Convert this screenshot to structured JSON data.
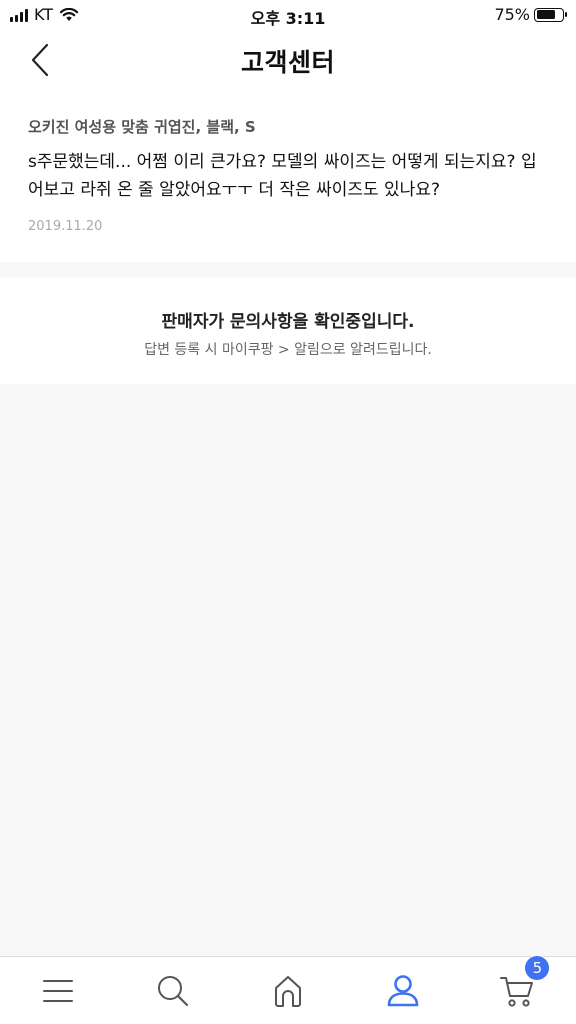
{
  "status_bar": {
    "carrier": "KT",
    "time": "오후 3:11",
    "battery": "75%",
    "battery_level": 0.75
  },
  "header": {
    "title": "고객센터",
    "back_icon": "chevron-left-icon"
  },
  "question": {
    "product": "오키진 여성용 맞춤 귀엽진, 블랙, S",
    "text": "s주문했는데... 어쩜 이리 큰가요? 모델의 싸이즈는 어떻게 되는지요? 입어보고 라쥐 온 줄 알았어요ㅜㅜ 더 작은 싸이즈도 있나요?",
    "date": "2019.11.20"
  },
  "answer": {
    "status_title": "판매자가 문의사항을 확인중입니다.",
    "status_sub": "답변 등록 시 마이쿠팡 > 알림으로 알려드립니다."
  },
  "tab_bar": {
    "items": [
      {
        "icon": "menu-icon"
      },
      {
        "icon": "search-icon"
      },
      {
        "icon": "home-icon"
      },
      {
        "icon": "user-icon",
        "active": true
      },
      {
        "icon": "cart-icon"
      }
    ],
    "cart_count": "5",
    "active_color": "#3e72f2",
    "inactive_color": "#555555"
  }
}
